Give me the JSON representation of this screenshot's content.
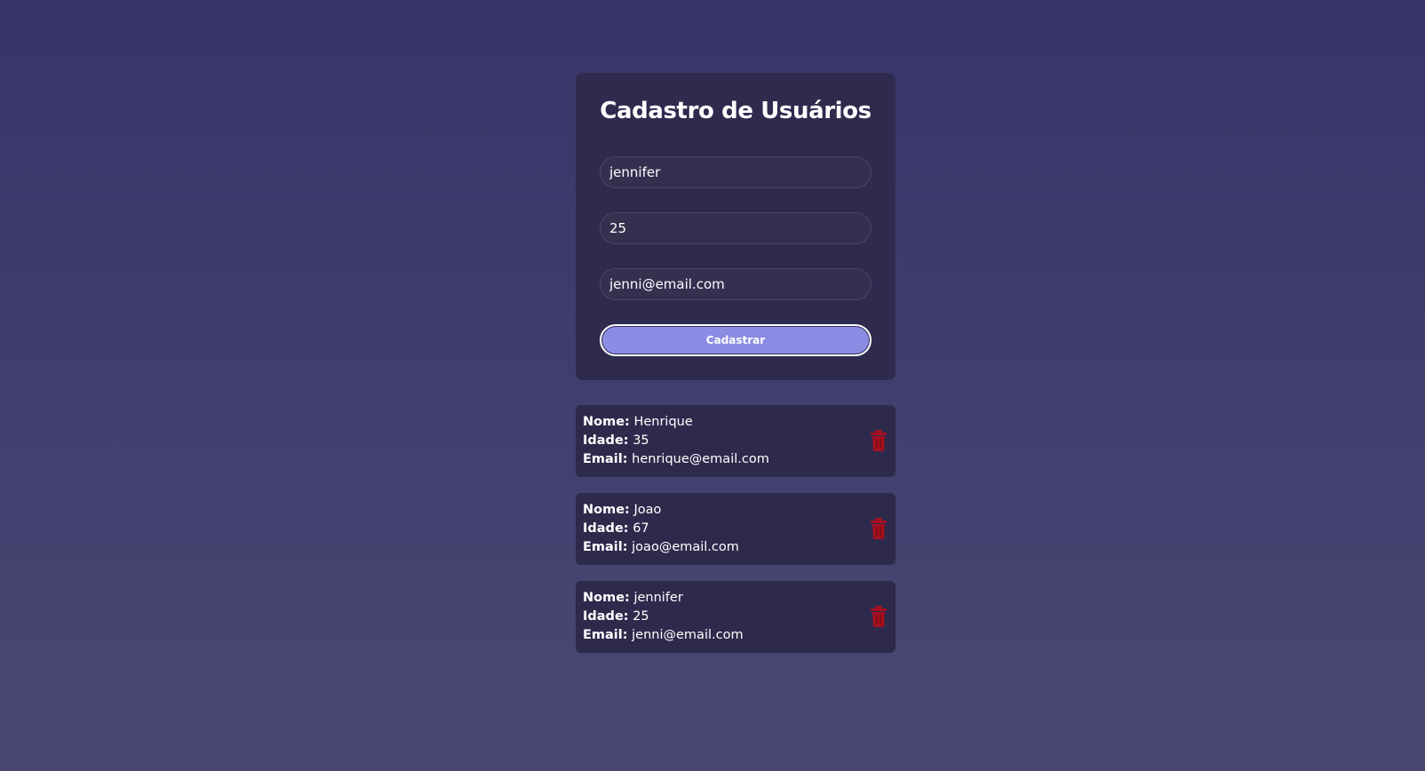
{
  "form": {
    "title": "Cadastro de Usuários",
    "name_value": "jennifer",
    "age_value": "25",
    "email_value": "jenni@email.com",
    "submit_label": "Cadastrar"
  },
  "labels": {
    "name": "Nome:",
    "age": "Idade:",
    "email": "Email:"
  },
  "users": [
    {
      "nome": "Henrique",
      "idade": "35",
      "email": "henrique@email.com"
    },
    {
      "nome": "Joao",
      "idade": "67",
      "email": "joao@email.com"
    },
    {
      "nome": "jennifer",
      "idade": "25",
      "email": "jenni@email.com"
    }
  ],
  "icons": {
    "delete": "trash-icon"
  },
  "colors": {
    "background_top": "#383469",
    "background_bottom": "#4a4873",
    "card": "#2f2b4f",
    "button": "#8b8ce3",
    "delete": "#a3101f"
  }
}
